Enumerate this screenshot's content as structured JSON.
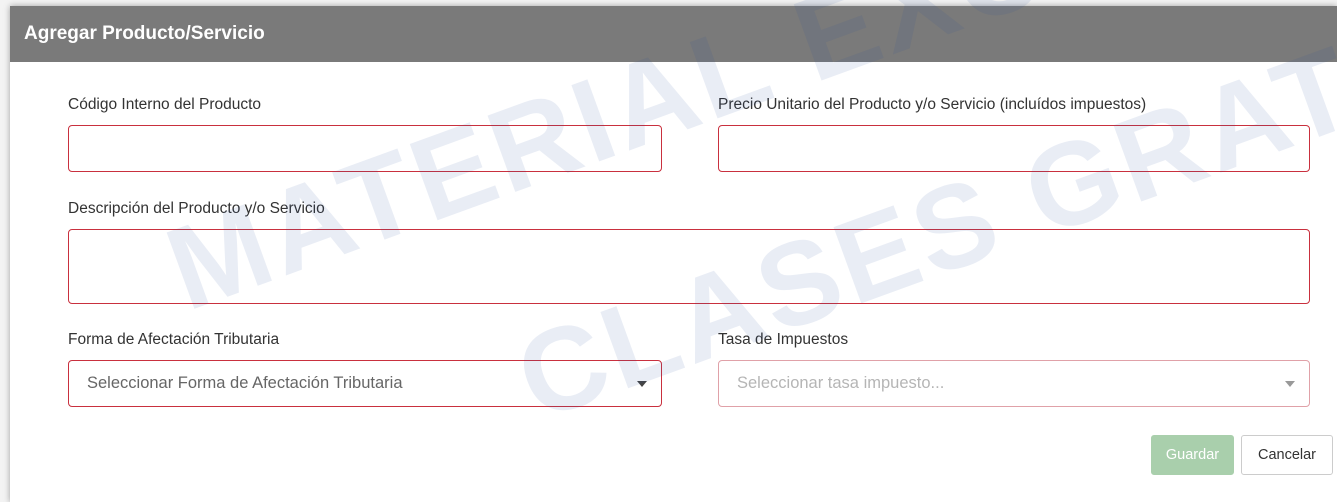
{
  "dialog": {
    "title": "Agregar Producto/Servicio",
    "fields": {
      "internal_code": {
        "label": "Código Interno del Producto",
        "value": ""
      },
      "unit_price": {
        "label": "Precio Unitario del Producto y/o Servicio (incluídos impuestos)",
        "value": ""
      },
      "description": {
        "label": "Descripción del Producto y/o Servicio",
        "value": ""
      },
      "tax_form": {
        "label": "Forma de Afectación Tributaria",
        "selected": "Seleccionar Forma de Afectación Tributaria"
      },
      "tax_rate": {
        "label": "Tasa de Impuestos",
        "selected": "Seleccionar tasa impuesto..."
      }
    },
    "buttons": {
      "save": "Guardar",
      "cancel": "Cancelar"
    }
  },
  "watermark": {
    "line1": "MATERIAL EXCLUSIVO PARA",
    "line2": "CLASES GRATUITAS DE IN"
  },
  "colors": {
    "header_bg": "#7a7a7a",
    "field_border_error": "#c9303e",
    "save_button_disabled": "#a9cfac"
  },
  "icons": {
    "select_caret": "chevron-down-icon"
  }
}
